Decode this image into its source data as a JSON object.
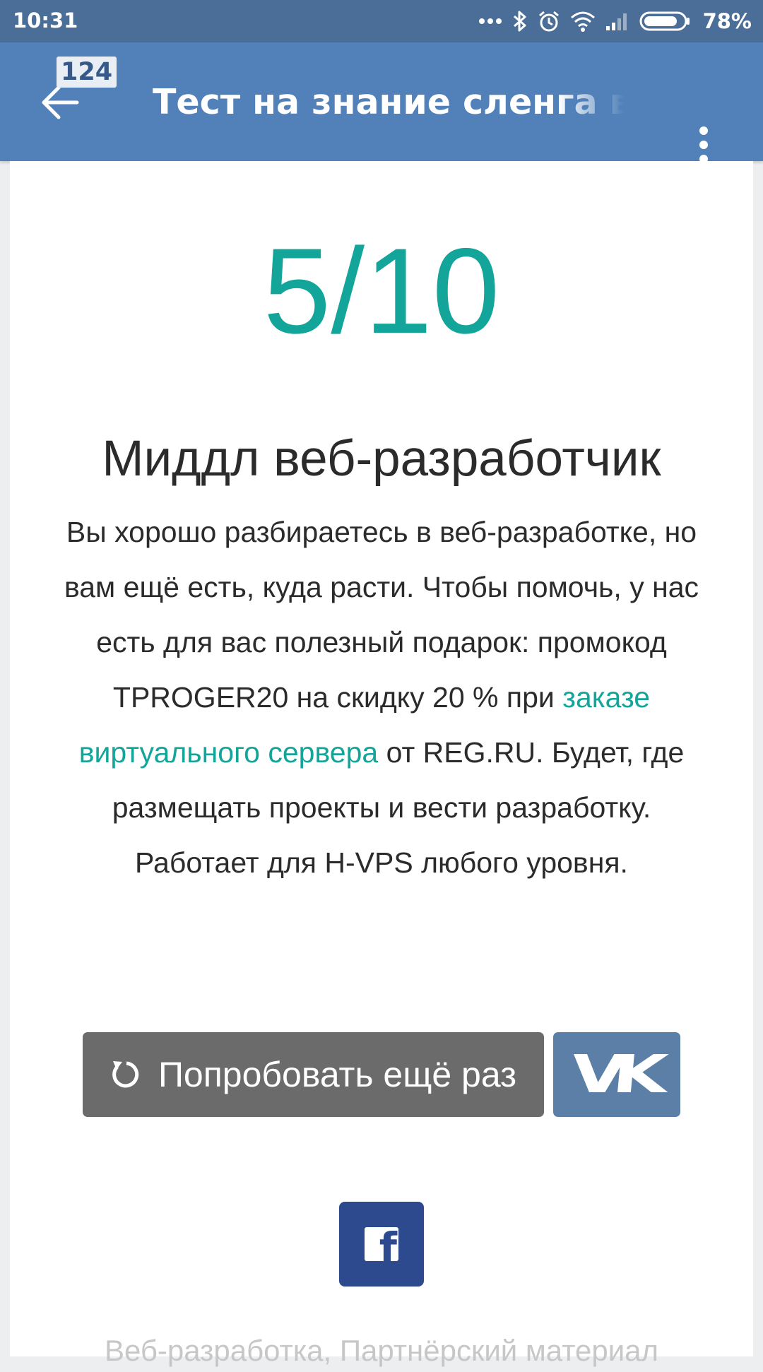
{
  "status_bar": {
    "time": "10:31",
    "battery_percent": "78%",
    "icons": [
      "more-dots-icon",
      "bluetooth-icon",
      "alarm-icon",
      "wifi-icon",
      "signal-icon",
      "battery-icon"
    ]
  },
  "toolbar": {
    "badge_count": "124",
    "title": "Тест на знание сленга веб-разработчиков",
    "back_icon": "arrow-left-icon",
    "menu_icon": "more-vertical-icon"
  },
  "result": {
    "score": "5/10",
    "title": "Миддл веб-разработчик",
    "desc_part1": "Вы хорошо разбираетесь в веб-разработке, но вам ещё есть, куда расти. Чтобы помочь, у нас есть для вас полезный подарок: промокод TPROGER20 на скидку 20 % при ",
    "desc_link": "заказе виртуального сервера",
    "desc_part2": " от REG.RU. Будет, где размещать проекты и вести разработку. Работает для H-VPS любого уровня."
  },
  "actions": {
    "retry_label": "Попробовать ещё раз",
    "retry_icon": "refresh-icon",
    "vk_label": "VK",
    "fb_label": "f"
  },
  "footer": {
    "tags_text": "Веб-разработка, Партнёрский материал"
  },
  "colors": {
    "status_bar": "#4a6e98",
    "toolbar": "#5181b8",
    "accent": "#14a59a",
    "retry_button": "#6b6b6b",
    "vk_button": "#5b7fa6",
    "fb_button": "#2d4a8f"
  }
}
